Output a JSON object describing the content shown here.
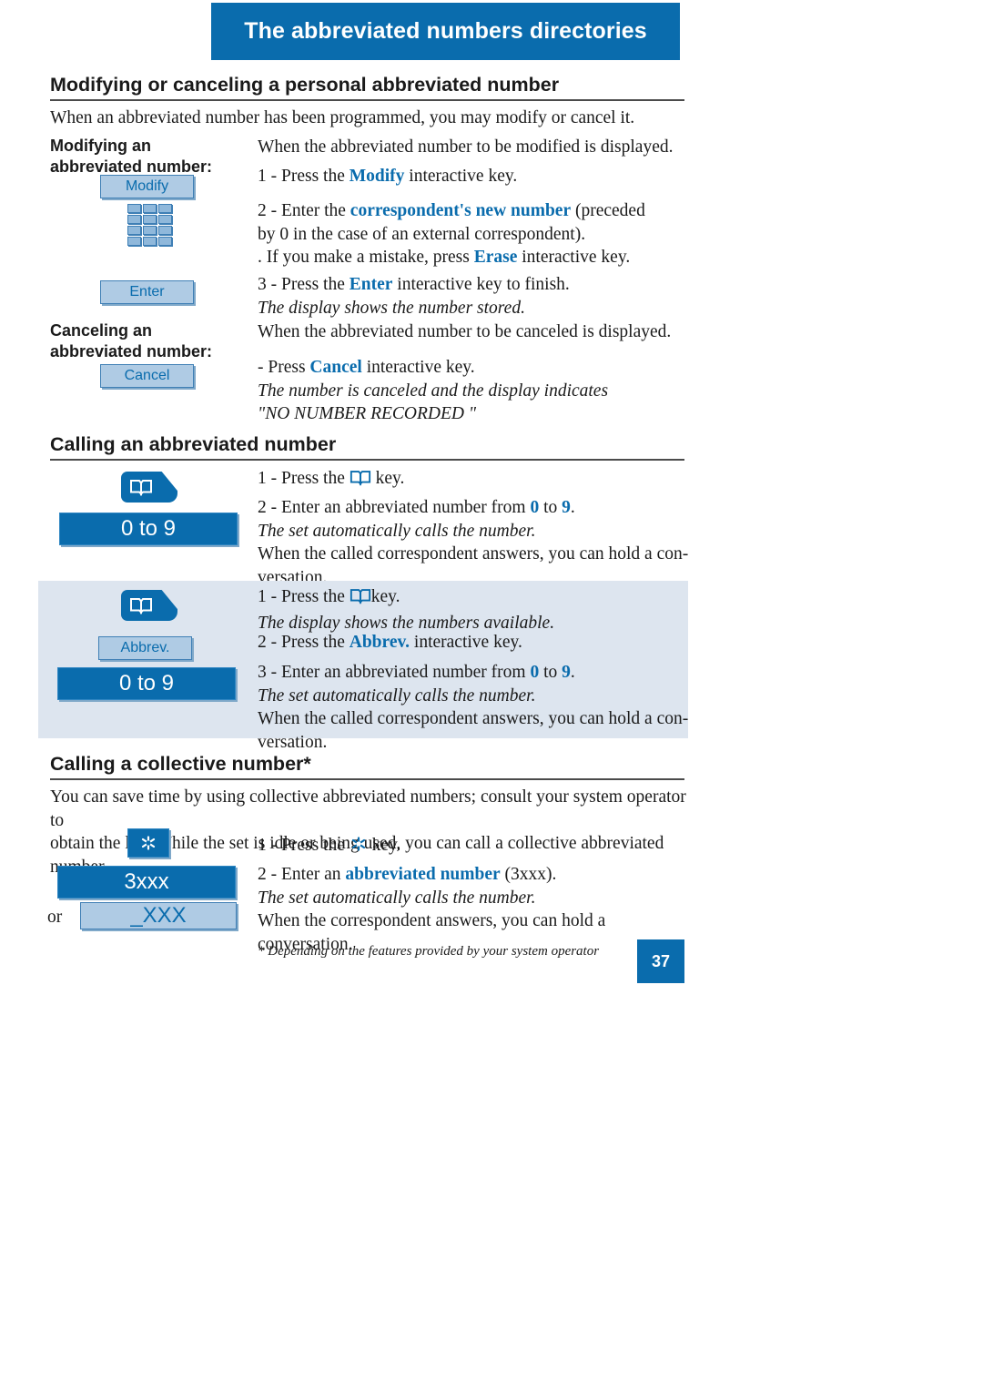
{
  "header": {
    "title": "The abbreviated numbers directories"
  },
  "sections": [
    {
      "id": "modify-cancel",
      "title": "Modifying or canceling a personal abbreviated number",
      "intro": "When an abbreviated number has been programmed, you may modify or cancel it.",
      "subheads": [
        {
          "line1": "Modifying an",
          "line2": "abbreviated number:"
        },
        {
          "line1": "Canceling an",
          "line2": "abbreviated number:"
        }
      ],
      "keys": {
        "modify": "Modify",
        "enter": "Enter",
        "cancel": "Cancel",
        "keypad_icon": "keypad-icon"
      },
      "steps": {
        "modify_lead": "When the abbreviated number to be modified is displayed.",
        "step1_pre": "1 - Press the ",
        "step1_key": "Modify",
        "step1_post": " interactive key.",
        "step2_pre": "2 - Enter the ",
        "step2_key": "correspondent's new number",
        "step2_post": " (preceded",
        "step2_line2": "by 0 in the case of an external correspondent).",
        "step2_line3_pre": ". If you make a mistake, press ",
        "step2_line3_key": "Erase",
        "step2_line3_post": " interactive key.",
        "step3_pre": "3 - Press the ",
        "step3_key": "Enter",
        "step3_post": " interactive key to finish.",
        "step3_note": "The display shows the number stored.",
        "cancel_lead": "When the abbreviated number to be canceled is displayed.",
        "cancel_pre": "- Press ",
        "cancel_key": "Cancel",
        "cancel_post": " interactive key.",
        "cancel_note1": "The number is canceled and the display indicates",
        "cancel_note2": "\"NO NUMBER RECORDED \""
      }
    },
    {
      "id": "calling-abbrev",
      "title": "Calling an abbreviated number",
      "block_a": {
        "key_range": "0 to 9",
        "step1_pre": "1 - Press the ",
        "step1_icon": "directory-book-icon",
        "step1_post": " key.",
        "step2_pre": "2 - Enter an abbreviated number from ",
        "step2_from": "0",
        "step2_mid": " to ",
        "step2_to": "9",
        "step2_post": ".",
        "note": "The set automatically calls the number.",
        "tail_line1": "When the called correspondent answers, you can hold a con-",
        "tail_line2": "versation."
      },
      "block_b": {
        "key_abbrev": "Abbrev.",
        "key_range": "0 to 9",
        "step1_pre": "1 - Press the ",
        "step1_icon": "directory-book-icon",
        "step1_post": "key.",
        "step1_note": "The display shows the numbers available.",
        "step2_pre": "2 - Press the ",
        "step2_key": "Abbrev.",
        "step2_post": " interactive key.",
        "step3_pre": "3 - Enter an abbreviated number from ",
        "step3_from": "0",
        "step3_mid": " to ",
        "step3_to": "9",
        "step3_post": ".",
        "step3_note": "The set automatically calls the number.",
        "tail_line1": "When the called correspondent answers, you can hold a con-",
        "tail_line2": "versation."
      }
    },
    {
      "id": "calling-collective",
      "title": "Calling a collective number*",
      "intro_line1": "You can save time by using collective abbreviated numbers; consult your system operator to",
      "intro_line2": "obtain the list. While the set is idle or being used, you can call a collective abbreviated number.",
      "keys": {
        "star": "star-key",
        "big": "3xxx",
        "alt": "_XXX",
        "or_label": "or"
      },
      "steps": {
        "step1_pre": "1 - Press the ",
        "step1_icon": "star-icon",
        "step1_post": " key.",
        "step2_pre": "2 - Enter an ",
        "step2_key": "abbreviated number",
        "step2_post": " (3xxx).",
        "step2_note": "The set automatically calls the number.",
        "tail": "When the correspondent answers, you can hold a conversation."
      }
    }
  ],
  "footer": {
    "footnote": "* Depending on the features provided by your system operator",
    "page_number": "37"
  },
  "colors": {
    "brand_blue": "#0a6cad",
    "light_key": "#afcbe4",
    "shaded_block": "#dde5ef",
    "text": "#1a1a1a"
  }
}
